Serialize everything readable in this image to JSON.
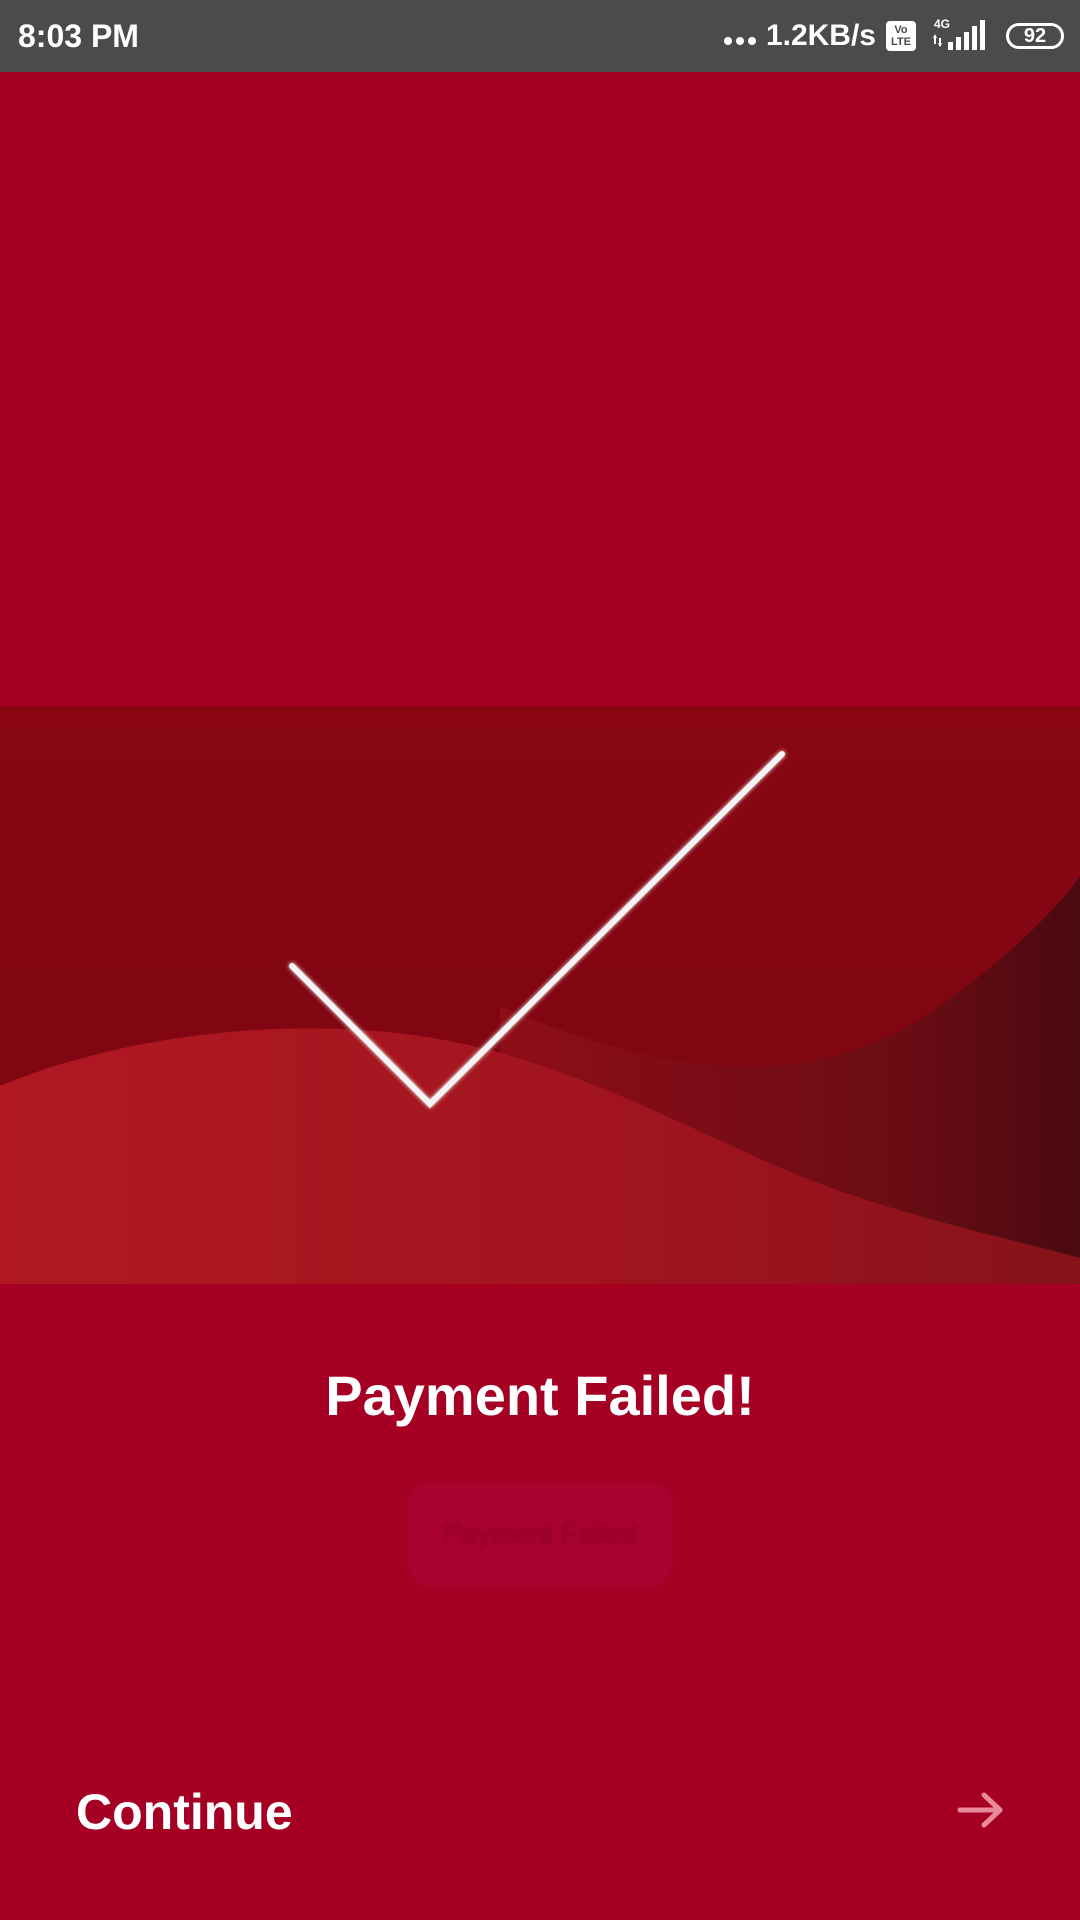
{
  "status_bar": {
    "time": "8:03 PM",
    "net_speed": "1.2KB/s",
    "volte_line1": "Vo",
    "volte_line2": "LTE",
    "network_type": "4G",
    "battery_level": "92"
  },
  "hero": {
    "icon": "checkmark-icon"
  },
  "main": {
    "title": "Payment Failed!",
    "ghost_button_label": "Payment Failed"
  },
  "footer": {
    "continue_label": "Continue",
    "arrow_icon": "arrow-right-icon"
  },
  "colors": {
    "background": "#a50024",
    "status_bar": "#4b4b4b",
    "text": "#ffffff"
  }
}
